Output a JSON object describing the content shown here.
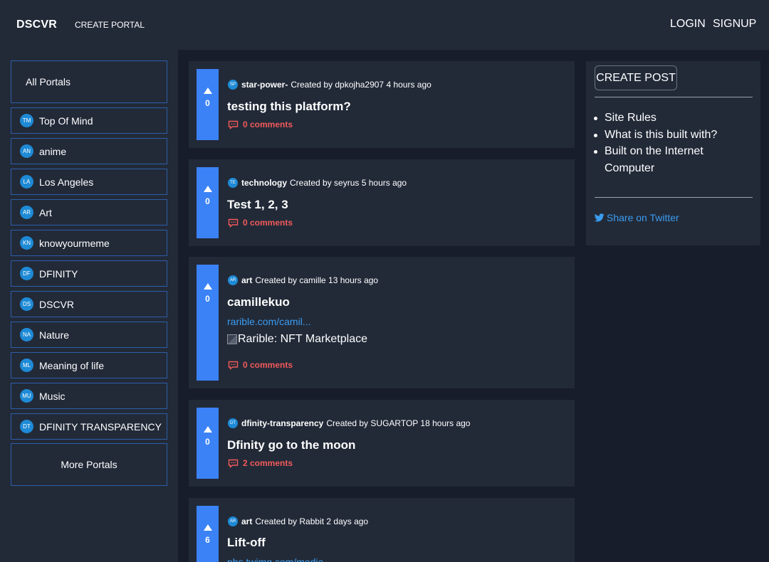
{
  "header": {
    "brand": "DSCVR",
    "create_portal": "CREATE PORTAL",
    "login": "LOGIN",
    "signup": "SIGNUP"
  },
  "sidebar": {
    "all_portals": "All Portals",
    "items": [
      {
        "badge": "TM",
        "label": "Top Of Mind"
      },
      {
        "badge": "AN",
        "label": "anime"
      },
      {
        "badge": "LA",
        "label": "Los Angeles"
      },
      {
        "badge": "AR",
        "label": "Art"
      },
      {
        "badge": "KN",
        "label": "knowyourmeme"
      },
      {
        "badge": "DF",
        "label": "DFINITY"
      },
      {
        "badge": "DS",
        "label": "DSCVR"
      },
      {
        "badge": "NA",
        "label": "Nature"
      },
      {
        "badge": "ML",
        "label": "Meaning of life"
      },
      {
        "badge": "MU",
        "label": "Music"
      },
      {
        "badge": "DT",
        "label": "DFINITY TRANSPARENCY"
      }
    ],
    "more_portals": "More Portals"
  },
  "posts": [
    {
      "votes": "0",
      "badge": "SP",
      "portal": "star-power-",
      "meta": "Created by dpkojha2907 4 hours ago",
      "title": "testing this platform?",
      "comments": "0 comments"
    },
    {
      "votes": "0",
      "badge": "TE",
      "portal": "technology",
      "meta": "Created by seyrus 5 hours ago",
      "title": "Test 1, 2, 3",
      "comments": "0 comments"
    },
    {
      "votes": "0",
      "badge": "AR",
      "portal": "art",
      "meta": "Created by camille 13 hours ago",
      "title": "camillekuo",
      "link": "rarible.com/camil...",
      "image_alt": "Rarible: NFT Marketplace",
      "comments": "0 comments"
    },
    {
      "votes": "0",
      "badge": "DT",
      "portal": "dfinity-transparency",
      "meta": "Created by SUGARTOP 18 hours ago",
      "title": "Dfinity go to the moon",
      "comments": "2 comments"
    },
    {
      "votes": "6",
      "badge": "AR",
      "portal": "art",
      "meta": "Created by Rabbit 2 days ago",
      "title": "Lift-off",
      "link": "pbs.twimg.com/media..."
    }
  ],
  "right_panel": {
    "create_post": "CREATE POST",
    "rules": [
      "Site Rules",
      "What is this built with?",
      "Built on the Internet Computer"
    ],
    "share": "Share on Twitter"
  },
  "colors": {
    "background": "#222a38",
    "feed_background": "#171d2a",
    "accent_blue": "#3b82f6",
    "comments_red": "#f25a5a",
    "link_blue": "#3b9cf0",
    "badge_blue": "#1e8ad6"
  }
}
